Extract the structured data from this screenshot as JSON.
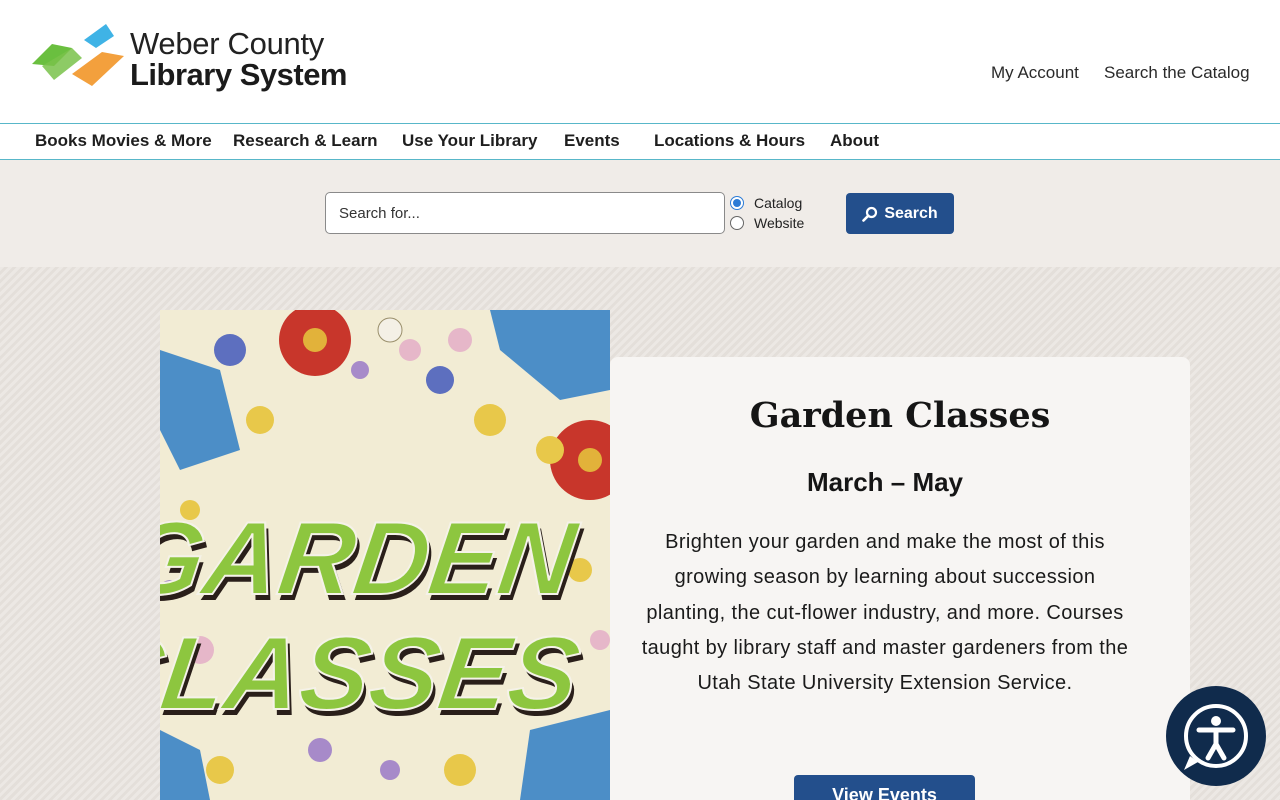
{
  "header": {
    "logo_line1": "Weber County",
    "logo_line2": "Library System",
    "util_links": {
      "account": "My Account",
      "catalog": "Search the Catalog"
    }
  },
  "nav": {
    "items": [
      "Books Movies & More",
      "Research & Learn",
      "Use Your Library",
      "Events",
      "Locations & Hours",
      "About"
    ]
  },
  "search": {
    "placeholder": "Search for...",
    "options": [
      {
        "label": "Catalog",
        "selected": true
      },
      {
        "label": "Website",
        "selected": false
      }
    ],
    "button_label": "Search"
  },
  "hero": {
    "poster_text": [
      "GARDEN",
      "CLASSES"
    ],
    "title": "Garden Classes",
    "subtitle": "March – May",
    "body": "Brighten your garden and make the most of this growing season by learning about succession planting, the cut-flower industry, and more. Courses taught by library staff and master gardeners from the Utah State University Extension Service.",
    "button_label": "View Events"
  },
  "colors": {
    "brand_blue": "#234f8c",
    "nav_rule": "#58b7c9",
    "search_band": "#f0ece8",
    "hero_bg": "#e8e3de",
    "poster_green": "#8dc63f",
    "a11y_bg": "#102b4c"
  },
  "icons": {
    "search_button": "magnifier-icon",
    "accessibility": "accessibility-icon"
  }
}
